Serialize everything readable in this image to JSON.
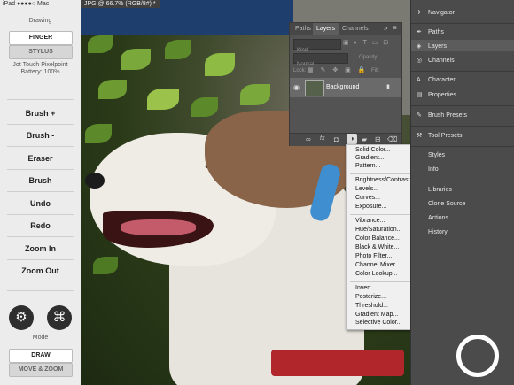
{
  "statusbar": {
    "text": "iPad ●●●●○ Mac"
  },
  "window_title": "JPG @ 66.7% (RGB/8#) *",
  "left_panel": {
    "drawing_label": "Drawing",
    "finger_label": "FINGER",
    "stylus_label": "STYLUS",
    "stylus_info_1": "Jot Touch Pixelpoint",
    "stylus_info_2": "Battery: 100%",
    "commands": [
      "Brush +",
      "Brush -",
      "Eraser",
      "Brush",
      "Undo",
      "Redo",
      "Zoom In",
      "Zoom Out"
    ],
    "gear_glyph": "⚙",
    "cmd_glyph": "⌘",
    "mode_label": "Mode",
    "draw_label": "DRAW",
    "move_zoom_label": "MOVE & ZOOM"
  },
  "layers_panel": {
    "tabs": [
      "Paths",
      "Layers",
      "Channels"
    ],
    "kind_label": "Kind",
    "blend_mode": "Normal",
    "opacity_label": "Opacity:",
    "lock_label": "Lock:",
    "fill_label": "Fill:",
    "layer_name": "Background",
    "menu_glyph": "≡"
  },
  "context_menu": {
    "groups": [
      [
        "Solid Color...",
        "Gradient...",
        "Pattern..."
      ],
      [
        "Brightness/Contrast...",
        "Levels...",
        "Curves...",
        "Exposure..."
      ],
      [
        "Vibrance...",
        "Hue/Saturation...",
        "Color Balance...",
        "Black & White...",
        "Photo Filter...",
        "Channel Mixer...",
        "Color Lookup..."
      ],
      [
        "Invert",
        "Posterize...",
        "Threshold...",
        "Gradient Map...",
        "Selective Color..."
      ]
    ]
  },
  "dock": {
    "items": [
      "Navigator",
      "Paths",
      "Layers",
      "Channels",
      "Character",
      "Properties",
      "Brush Presets",
      "Tool Presets",
      "Styles",
      "Info",
      "Libraries",
      "Clone Source",
      "Actions",
      "History"
    ]
  },
  "colors": {
    "panel_bg": "#535353",
    "dock_bg": "#4b4b4b",
    "left_bg": "#ececec",
    "menu_bg": "#f0f0f0"
  }
}
